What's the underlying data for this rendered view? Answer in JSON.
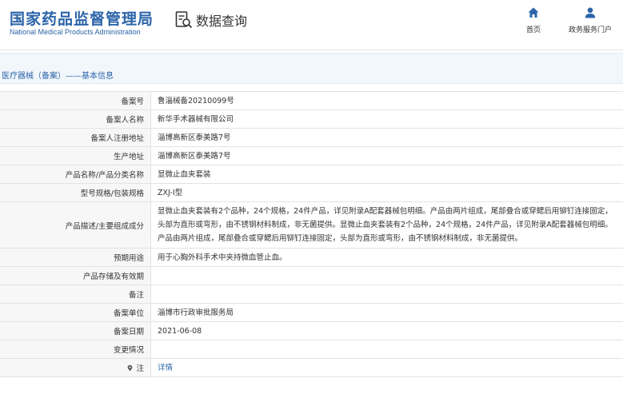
{
  "header": {
    "brand_cn": "国家药品监督管理局",
    "brand_en": "National Medical Products Administration",
    "query_label": "数据查询",
    "query_icon": "database-search-icon",
    "nav": [
      {
        "label": "首页",
        "icon": "home-icon"
      },
      {
        "label": "政务服务门户",
        "icon": "user-icon"
      }
    ]
  },
  "breadcrumb": "医疗器械（备案）——基本信息",
  "colors": {
    "brand_blue": "#2b64a8",
    "label_bg": "#f7f7f7",
    "breadcrumb_bg": "#f2f7fc",
    "border": "#e3e3e3"
  },
  "rows": [
    {
      "label": "备案号",
      "value": "鲁淄械备20210099号"
    },
    {
      "label": "备案人名称",
      "value": "新华手术器械有限公司"
    },
    {
      "label": "备案人注册地址",
      "value": "淄博高新区泰美路7号"
    },
    {
      "label": "生产地址",
      "value": "淄博高新区泰美路7号"
    },
    {
      "label": "产品名称/产品分类名称",
      "value": "显微止血夹套装"
    },
    {
      "label": "型号规格/包装规格",
      "value": "ZXJ-I型"
    },
    {
      "label": "产品描述/主要组成成分",
      "value": "显微止血夹套装有2个品种，24个规格，24件产品，详见附录A配套器械包明细。产品由两片组成，尾部叠合或穿鳃后用铆钉连接固定，头部为直形或弯形，由不锈钢材料制成，非无菌提供。显微止血夹套装有2个品种，24个规格，24件产品，详见附录A配套器械包明细。产品由两片组成，尾部叠合或穿鳃后用铆钉连接固定，头部为直形或弯形，由不锈钢材料制成，非无菌提供。"
    },
    {
      "label": "预期用途",
      "value": "用于心胸外科手术中夹持微血管止血。"
    },
    {
      "label": "产品存储及有效期",
      "value": ""
    },
    {
      "label": "备注",
      "value": ""
    },
    {
      "label": "备案单位",
      "value": "淄博市行政审批服务局"
    },
    {
      "label": "备案日期",
      "value": "2021-06-08"
    },
    {
      "label": "变更情况",
      "value": ""
    },
    {
      "label": "注",
      "value": "详情",
      "icon": "location-pin-icon"
    }
  ]
}
